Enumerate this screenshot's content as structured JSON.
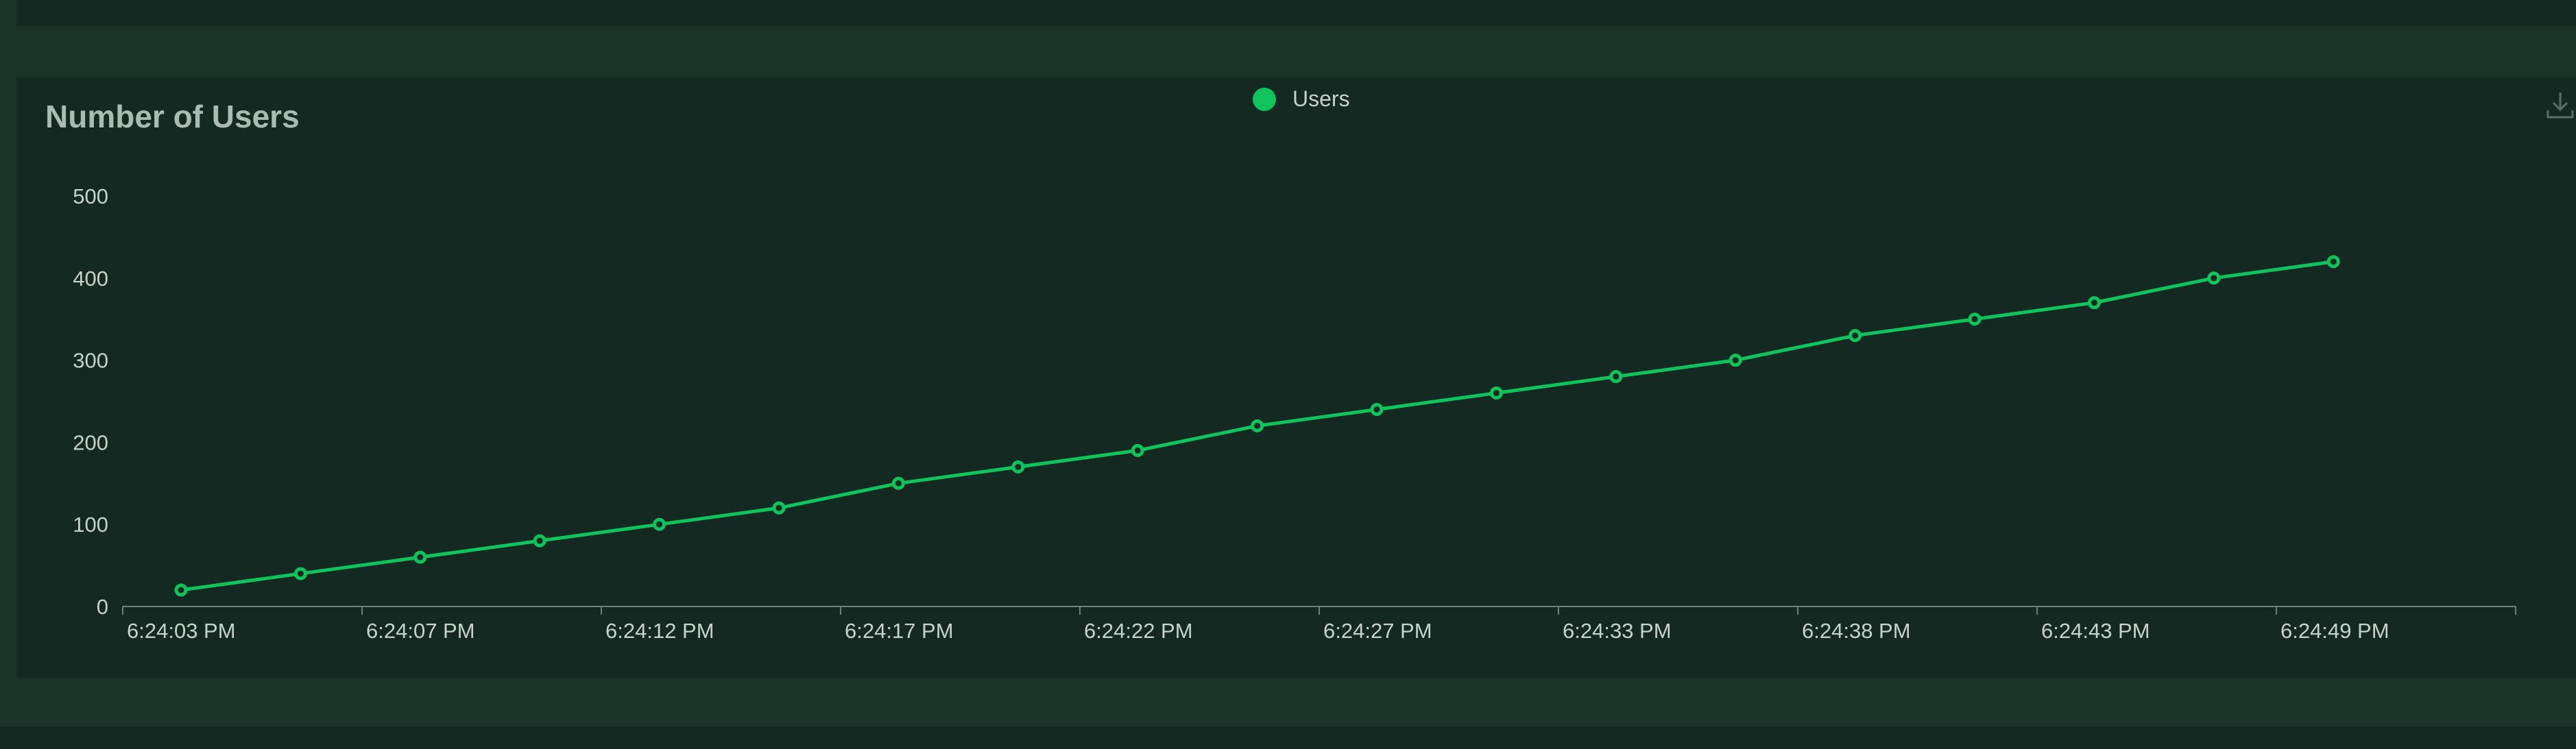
{
  "chart_data": {
    "type": "line",
    "title": "Number of Users",
    "xlabel": "",
    "ylabel": "",
    "ylim": [
      0,
      500
    ],
    "y_ticks": [
      0,
      100,
      200,
      300,
      400,
      500
    ],
    "x_tick_labels": [
      "6:24:03 PM",
      "6:24:07 PM",
      "6:24:12 PM",
      "6:24:17 PM",
      "6:24:22 PM",
      "6:24:27 PM",
      "6:24:33 PM",
      "6:24:38 PM",
      "6:24:43 PM",
      "6:24:49 PM"
    ],
    "legend_position": "top-center",
    "grid": false,
    "series": [
      {
        "name": "Users",
        "color": "#0fc45a",
        "values": [
          20,
          40,
          60,
          80,
          100,
          120,
          150,
          170,
          190,
          220,
          240,
          260,
          280,
          300,
          330,
          350,
          370,
          400,
          420
        ]
      }
    ]
  },
  "icons": {
    "download": "download-icon"
  }
}
